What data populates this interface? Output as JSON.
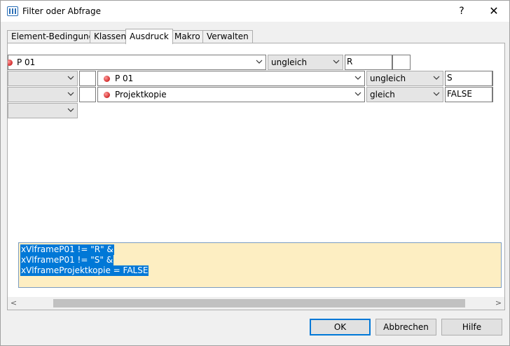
{
  "window": {
    "title": "Filter oder Abfrage",
    "help_glyph": "?",
    "close_glyph": "✕"
  },
  "tabs": [
    {
      "label": "Element-Bedingung"
    },
    {
      "label": "Klassen"
    },
    {
      "label": "Ausdruck",
      "active": true
    },
    {
      "label": "Makro"
    },
    {
      "label": "Verwalten"
    }
  ],
  "conditions": {
    "row1": {
      "field": "P 01",
      "operator": "ungleich",
      "value": "R"
    },
    "row2": {
      "field": "P 01",
      "operator": "ungleich",
      "value": "S"
    },
    "row3": {
      "field": "Projektkopie",
      "operator": "gleich",
      "value": "FALSE"
    }
  },
  "expression": {
    "lines": [
      "xVlframeP01 != \"R\" &",
      "xVlframeP01 != \"S\" &",
      "xVlframeProjektkopie = FALSE"
    ]
  },
  "scrollbar": {
    "left_glyph": "<",
    "right_glyph": ">"
  },
  "buttons": {
    "ok": "OK",
    "cancel": "Abbrechen",
    "help": "Hilfe"
  },
  "colors": {
    "accent": "#0078d7",
    "expression_bg": "#fdeec2",
    "indicator_red": "#d12c2c"
  }
}
